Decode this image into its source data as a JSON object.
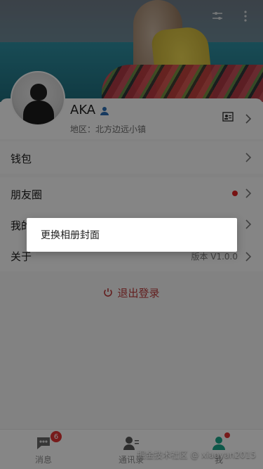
{
  "profile": {
    "name": "AKA",
    "region": "地区：北方边远小镇"
  },
  "list": [
    {
      "label": "钱包"
    },
    {
      "label": "朋友圈"
    },
    {
      "label": "我的"
    },
    {
      "label": "关于",
      "value": "版本 V1.0.0"
    }
  ],
  "logout_label": "退出登录",
  "dialog": {
    "item": "更换相册封面"
  },
  "tabs": [
    {
      "label": "消息",
      "badge": "6"
    },
    {
      "label": "通讯录"
    },
    {
      "label": "我"
    }
  ],
  "watermark": "掘金技术社区 @ xiaoyan2015",
  "colors": {
    "accent": "#1aa388",
    "alert": "#d33"
  },
  "icons": [
    "filter-icon",
    "more-vert-icon",
    "user-badge-icon",
    "contact-card-icon",
    "chevron-right-icon",
    "power-icon",
    "message-icon",
    "contacts-icon",
    "me-icon"
  ]
}
